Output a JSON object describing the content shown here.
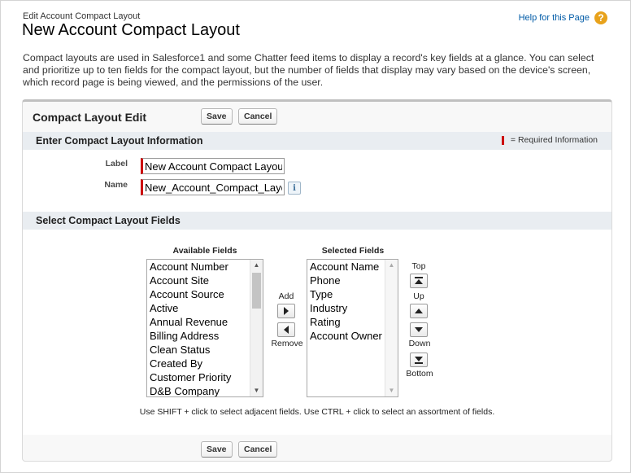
{
  "breadcrumb": "Edit Account Compact Layout",
  "title": "New Account Compact Layout",
  "help": {
    "label": "Help for this Page",
    "icon": "question-icon"
  },
  "intro": "Compact layouts are used in Salesforce1 and some Chatter feed items to display a record's key fields at a glance. You can select and prioritize up to ten fields for the compact layout, but the number of fields that display may vary based on the device's screen, which record page is being viewed, and the permissions of the user.",
  "panel": {
    "title": "Compact Layout Edit",
    "save": "Save",
    "cancel": "Cancel"
  },
  "info_section": {
    "title": "Enter Compact Layout Information",
    "required_legend": "= Required Information",
    "label_label": "Label",
    "label_value": "New Account Compact Layout",
    "name_label": "Name",
    "name_value": "New_Account_Compact_Layout"
  },
  "fields_section": {
    "title": "Select Compact Layout Fields",
    "available_header": "Available Fields",
    "selected_header": "Selected Fields",
    "available": [
      "Account Number",
      "Account Site",
      "Account Source",
      "Active",
      "Annual Revenue",
      "Billing Address",
      "Clean Status",
      "Created By",
      "Customer Priority",
      "D&B Company"
    ],
    "selected": [
      "Account Name",
      "Phone",
      "Type",
      "Industry",
      "Rating",
      "Account Owner"
    ],
    "add": "Add",
    "remove": "Remove",
    "top": "Top",
    "up": "Up",
    "down": "Down",
    "bottom": "Bottom",
    "hint": "Use SHIFT + click to select adjacent fields. Use CTRL + click to select an assortment of fields."
  },
  "colors": {
    "required": "#cc0000",
    "section_bg": "#e9edf1",
    "help_icon": "#e8a21b"
  }
}
